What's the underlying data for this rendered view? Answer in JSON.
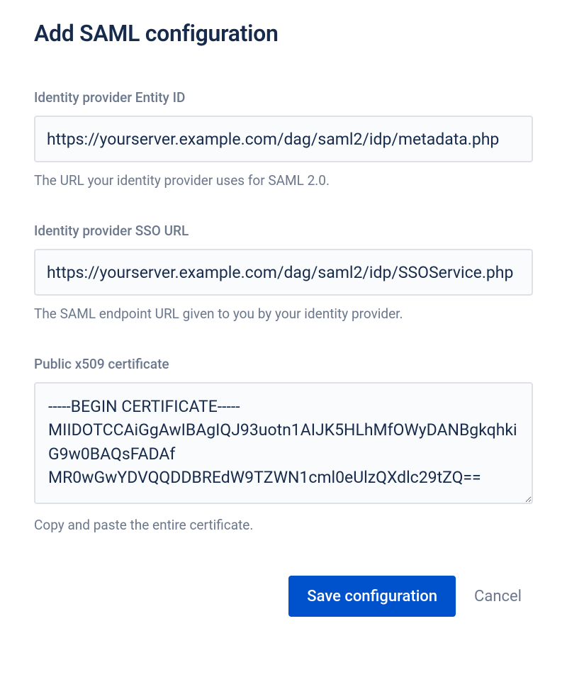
{
  "title": "Add SAML configuration",
  "fields": {
    "entity_id": {
      "label": "Identity provider Entity ID",
      "value": "https://yourserver.example.com/dag/saml2/idp/metadata.php",
      "help": "The URL your identity provider uses for SAML 2.0."
    },
    "sso_url": {
      "label": "Identity provider SSO URL",
      "value": "https://yourserver.example.com/dag/saml2/idp/SSOService.php",
      "help": "The SAML endpoint URL given to you by your identity provider."
    },
    "certificate": {
      "label": "Public x509 certificate",
      "value": "-----BEGIN CERTIFICATE-----\nMIIDOTCCAiGgAwIBAgIQJ93uotn1AIJK5HLhMfOWyDANBgkqhkiG9w0BAQsFADAf\nMR0wGwYDVQQDDBREdW9TZWN1cml0eUlzQXdlc29tZQ==",
      "help": "Copy and paste the entire certificate."
    }
  },
  "buttons": {
    "save": "Save configuration",
    "cancel": "Cancel"
  }
}
